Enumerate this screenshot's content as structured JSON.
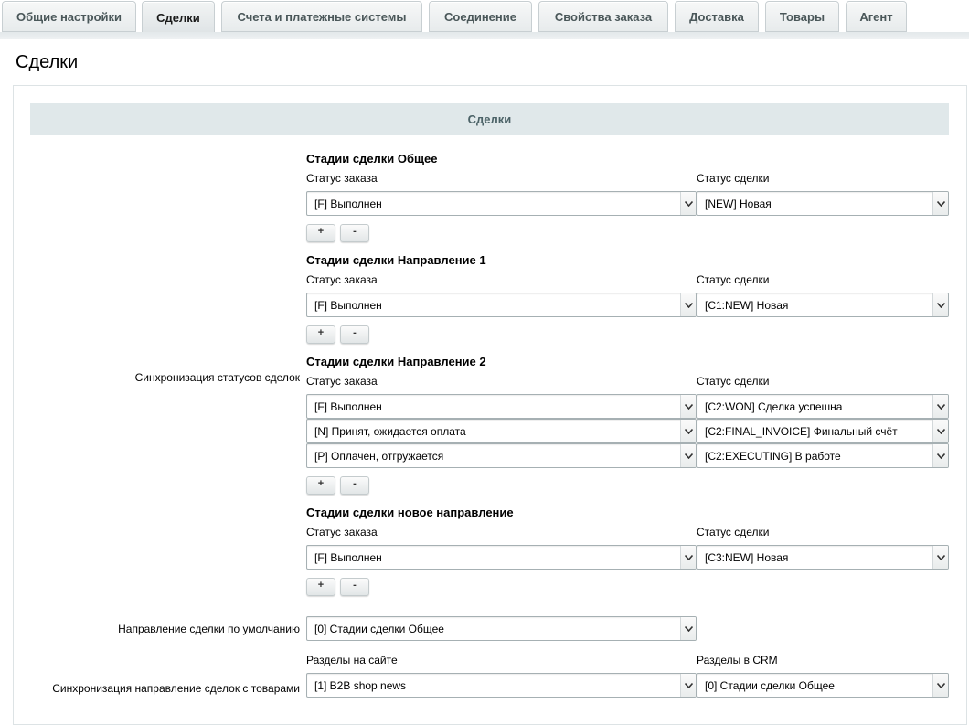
{
  "tabs": [
    {
      "label": "Общие настройки"
    },
    {
      "label": "Сделки"
    },
    {
      "label": "Счета и платежные системы"
    },
    {
      "label": "Соединение"
    },
    {
      "label": "Свойства заказа"
    },
    {
      "label": "Доставка"
    },
    {
      "label": "Товары"
    },
    {
      "label": "Агент"
    }
  ],
  "active_tab": "Сделки",
  "page": {
    "title": "Сделки",
    "section_header": "Сделки"
  },
  "sync_statuses": {
    "label": "Синхронизация статусов сделок",
    "groups": [
      {
        "title": "Стадии сделки Общее",
        "col_order": "Статус заказа",
        "col_deal": "Статус сделки",
        "rows": [
          {
            "order": "[F] Выполнен",
            "deal": "[NEW] Новая"
          }
        ]
      },
      {
        "title": "Стадии сделки Направление 1",
        "col_order": "Статус заказа",
        "col_deal": "Статус сделки",
        "rows": [
          {
            "order": "[F] Выполнен",
            "deal": "[C1:NEW] Новая"
          }
        ]
      },
      {
        "title": "Стадии сделки Направление 2",
        "col_order": "Статус заказа",
        "col_deal": "Статус сделки",
        "rows": [
          {
            "order": "[F] Выполнен",
            "deal": "[C2:WON] Сделка успешна"
          },
          {
            "order": "[N] Принят, ожидается оплата",
            "deal": "[C2:FINAL_INVOICE] Финальный счёт"
          },
          {
            "order": "[P] Оплачен, отгружается",
            "deal": "[C2:EXECUTING] В работе"
          }
        ]
      },
      {
        "title": "Стадии сделки новое направление",
        "col_order": "Статус заказа",
        "col_deal": "Статус сделки",
        "rows": [
          {
            "order": "[F] Выполнен",
            "deal": "[C3:NEW] Новая"
          }
        ]
      }
    ],
    "add_label": "+",
    "remove_label": "-"
  },
  "default_direction": {
    "label": "Направление сделки по умолчанию",
    "value": "[0] Стадии сделки Общее"
  },
  "sync_products": {
    "label": "Синхронизация направление сделок с товарами",
    "col_site": "Разделы на сайте",
    "col_crm": "Разделы в CRM",
    "site_value": "[1] B2B shop news",
    "crm_value": "[0] Стадии сделки Общее"
  }
}
